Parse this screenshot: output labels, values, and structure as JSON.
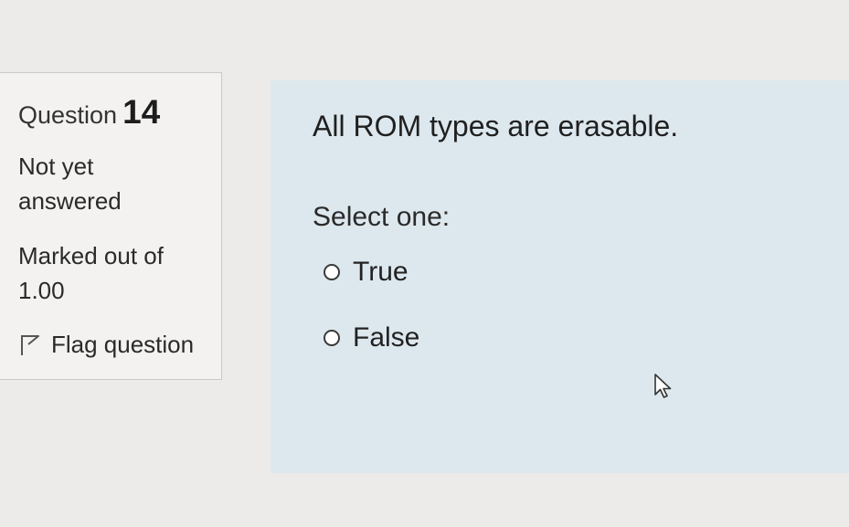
{
  "question_info": {
    "label": "Question",
    "number": "14",
    "state": "Not yet answered",
    "grade": "Marked out of 1.00",
    "flag": {
      "icon": "flag-icon",
      "label": "Flag question"
    }
  },
  "question": {
    "text": "All ROM types are erasable.",
    "prompt": "Select one:",
    "options": [
      {
        "label": "True",
        "selected": false
      },
      {
        "label": "False",
        "selected": false
      }
    ]
  },
  "colors": {
    "page_background": "#ecebea",
    "info_background": "#f3f2f1",
    "content_background": "#dde8ee"
  }
}
